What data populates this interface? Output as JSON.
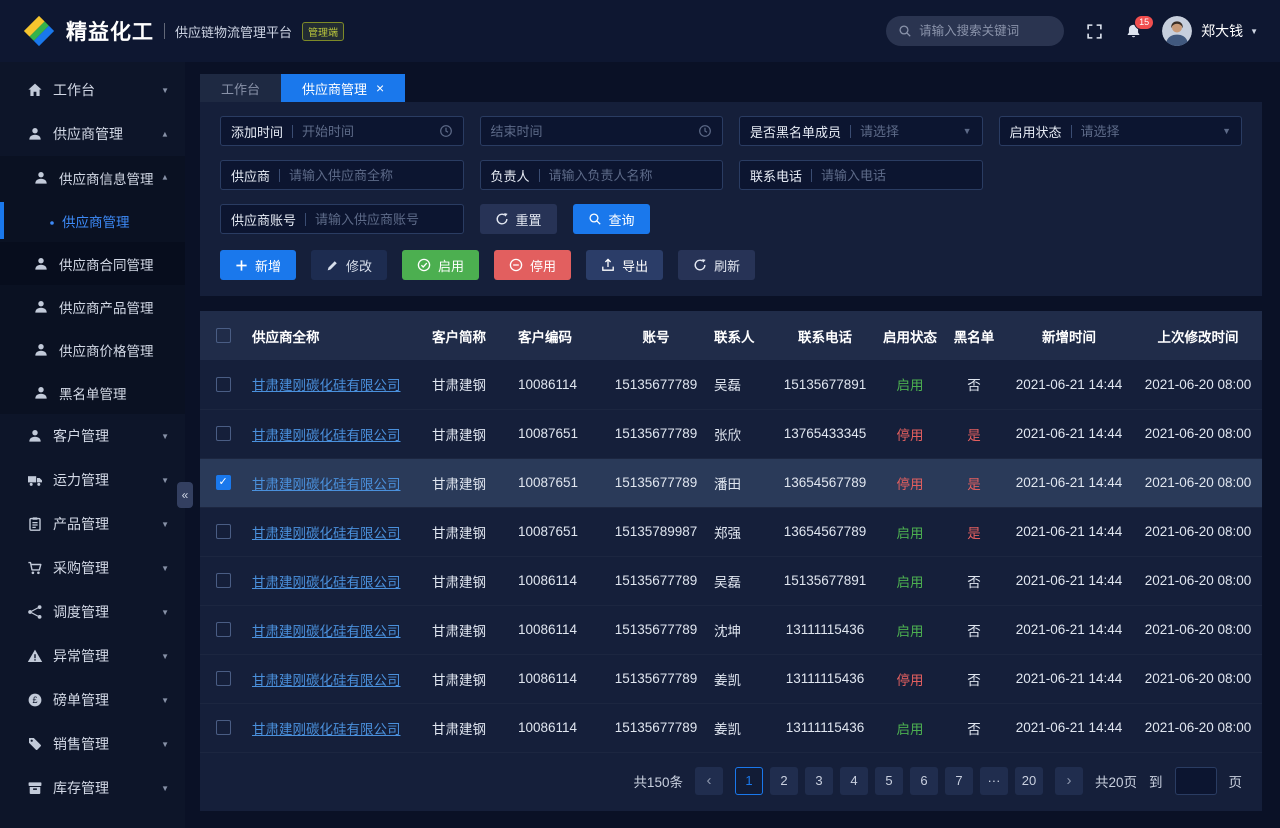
{
  "colors": {
    "accent": "#1a78ec",
    "green": "#4caf50",
    "red": "#e25f5f",
    "link": "#4a90dc",
    "badge-red": "#f04e4e"
  },
  "icons": {
    "close": "×",
    "caret": "▼",
    "collapse": "«",
    "prev": "‹",
    "next": "›"
  },
  "header": {
    "brand": "精益化工",
    "subtitle": "供应链物流管理平台",
    "badge": "管理端",
    "search_placeholder": "请输入搜索关键词",
    "notification_count": "15",
    "username": "郑大钱"
  },
  "sidebar": {
    "items": [
      {
        "label": "工作台",
        "icon": "home-icon",
        "level": 1,
        "chevron": "down"
      },
      {
        "label": "供应商管理",
        "icon": "user-icon",
        "level": 1,
        "chevron": "up"
      },
      {
        "label": "供应商信息管理",
        "icon": "user-icon",
        "level": 2,
        "submenu": true,
        "chevron": "up"
      },
      {
        "label": "供应商管理",
        "icon": "dot-icon",
        "level": 3,
        "submenu": true,
        "active": true
      },
      {
        "label": "供应商合同管理",
        "icon": "user-icon",
        "level": 2,
        "submenu": true,
        "hovered": true
      },
      {
        "label": "供应商产品管理",
        "icon": "user-icon",
        "level": 2,
        "submenu": true
      },
      {
        "label": "供应商价格管理",
        "icon": "user-icon",
        "level": 2,
        "submenu": true
      },
      {
        "label": "黑名单管理",
        "icon": "user-icon",
        "level": 2,
        "submenu": true
      },
      {
        "label": "客户管理",
        "icon": "user-icon",
        "level": 1,
        "chevron": "down"
      },
      {
        "label": "运力管理",
        "icon": "truck-icon",
        "level": 1,
        "chevron": "down"
      },
      {
        "label": "产品管理",
        "icon": "clipboard-icon",
        "level": 1,
        "chevron": "down"
      },
      {
        "label": "采购管理",
        "icon": "cart-icon",
        "level": 1,
        "chevron": "down"
      },
      {
        "label": "调度管理",
        "icon": "dispatch-icon",
        "level": 1,
        "chevron": "down"
      },
      {
        "label": "异常管理",
        "icon": "warning-icon",
        "level": 1,
        "chevron": "down"
      },
      {
        "label": "磅单管理",
        "icon": "pound-icon",
        "level": 1,
        "chevron": "down"
      },
      {
        "label": "销售管理",
        "icon": "tag-icon",
        "level": 1,
        "chevron": "down"
      },
      {
        "label": "库存管理",
        "icon": "inventory-icon",
        "level": 1,
        "chevron": "down"
      }
    ]
  },
  "tabs": [
    {
      "label": "工作台"
    },
    {
      "label": "供应商管理"
    }
  ],
  "filters": {
    "add_time_label": "添加时间",
    "start_placeholder": "开始时间",
    "end_placeholder": "结束时间",
    "blacklist_label": "是否黑名单成员",
    "blacklist_placeholder": "请选择",
    "status_label": "启用状态",
    "status_placeholder": "请选择",
    "supplier_label": "供应商",
    "supplier_placeholder": "请输入供应商全称",
    "manager_label": "负责人",
    "manager_placeholder": "请输入负责人名称",
    "phone_label": "联系电话",
    "phone_placeholder": "请输入电话",
    "account_label": "供应商账号",
    "account_placeholder": "请输入供应商账号",
    "reset_label": "重置",
    "search_label": "查询"
  },
  "actions": {
    "add": "新增",
    "edit": "修改",
    "enable": "启用",
    "disable": "停用",
    "export": "导出",
    "refresh": "刷新"
  },
  "table": {
    "columns": [
      "供应商全称",
      "客户简称",
      "客户编码",
      "账号",
      "联系人",
      "联系电话",
      "启用状态",
      "黑名单",
      "新增时间",
      "上次修改时间"
    ],
    "enabled_label": "启用",
    "blacklist_yes_label": "是",
    "rows": [
      {
        "full_name": "甘肃建刚碳化硅有限公司",
        "short_name": "甘肃建钢",
        "customer_code": "10086114",
        "account": "15135677789",
        "contact": "吴磊",
        "contact_phone": "15135677891",
        "status": "启用",
        "blacklist": "否",
        "created_at": "2021-06-21 14:44",
        "modified_at": "2021-06-20 08:00",
        "selected": false
      },
      {
        "full_name": "甘肃建刚碳化硅有限公司",
        "short_name": "甘肃建钢",
        "customer_code": "10087651",
        "account": "15135677789",
        "contact": "张欣",
        "contact_phone": "13765433345",
        "status": "停用",
        "blacklist": "是",
        "created_at": "2021-06-21 14:44",
        "modified_at": "2021-06-20 08:00",
        "selected": false
      },
      {
        "full_name": "甘肃建刚碳化硅有限公司",
        "short_name": "甘肃建钢",
        "customer_code": "10087651",
        "account": "15135677789",
        "contact": "潘田",
        "contact_phone": "13654567789",
        "status": "停用",
        "blacklist": "是",
        "created_at": "2021-06-21 14:44",
        "modified_at": "2021-06-20 08:00",
        "selected": true
      },
      {
        "full_name": "甘肃建刚碳化硅有限公司",
        "short_name": "甘肃建钢",
        "customer_code": "10087651",
        "account": "15135789987",
        "contact": "郑强",
        "contact_phone": "13654567789",
        "status": "启用",
        "blacklist": "是",
        "created_at": "2021-06-21 14:44",
        "modified_at": "2021-06-20 08:00",
        "selected": false
      },
      {
        "full_name": "甘肃建刚碳化硅有限公司",
        "short_name": "甘肃建钢",
        "customer_code": "10086114",
        "account": "15135677789",
        "contact": "吴磊",
        "contact_phone": "15135677891",
        "status": "启用",
        "blacklist": "否",
        "created_at": "2021-06-21 14:44",
        "modified_at": "2021-06-20 08:00",
        "selected": false
      },
      {
        "full_name": "甘肃建刚碳化硅有限公司",
        "short_name": "甘肃建钢",
        "customer_code": "10086114",
        "account": "15135677789",
        "contact": "沈坤",
        "contact_phone": "13111115436",
        "status": "启用",
        "blacklist": "否",
        "created_at": "2021-06-21 14:44",
        "modified_at": "2021-06-20 08:00",
        "selected": false
      },
      {
        "full_name": "甘肃建刚碳化硅有限公司",
        "short_name": "甘肃建钢",
        "customer_code": "10086114",
        "account": "15135677789",
        "contact": "姜凯",
        "contact_phone": "13111115436",
        "status": "停用",
        "blacklist": "否",
        "created_at": "2021-06-21 14:44",
        "modified_at": "2021-06-20 08:00",
        "selected": false
      },
      {
        "full_name": "甘肃建刚碳化硅有限公司",
        "short_name": "甘肃建钢",
        "customer_code": "10086114",
        "account": "15135677789",
        "contact": "姜凯",
        "contact_phone": "13111115436",
        "status": "启用",
        "blacklist": "否",
        "created_at": "2021-06-21 14:44",
        "modified_at": "2021-06-20 08:00",
        "selected": false
      }
    ]
  },
  "pagination": {
    "total_text": "共150条",
    "pages": [
      "1",
      "2",
      "3",
      "4",
      "5",
      "6",
      "7",
      "···",
      "20"
    ],
    "active_page": "1",
    "total_pages_text": "共20页",
    "jump_label": "到",
    "page_unit": "页"
  }
}
